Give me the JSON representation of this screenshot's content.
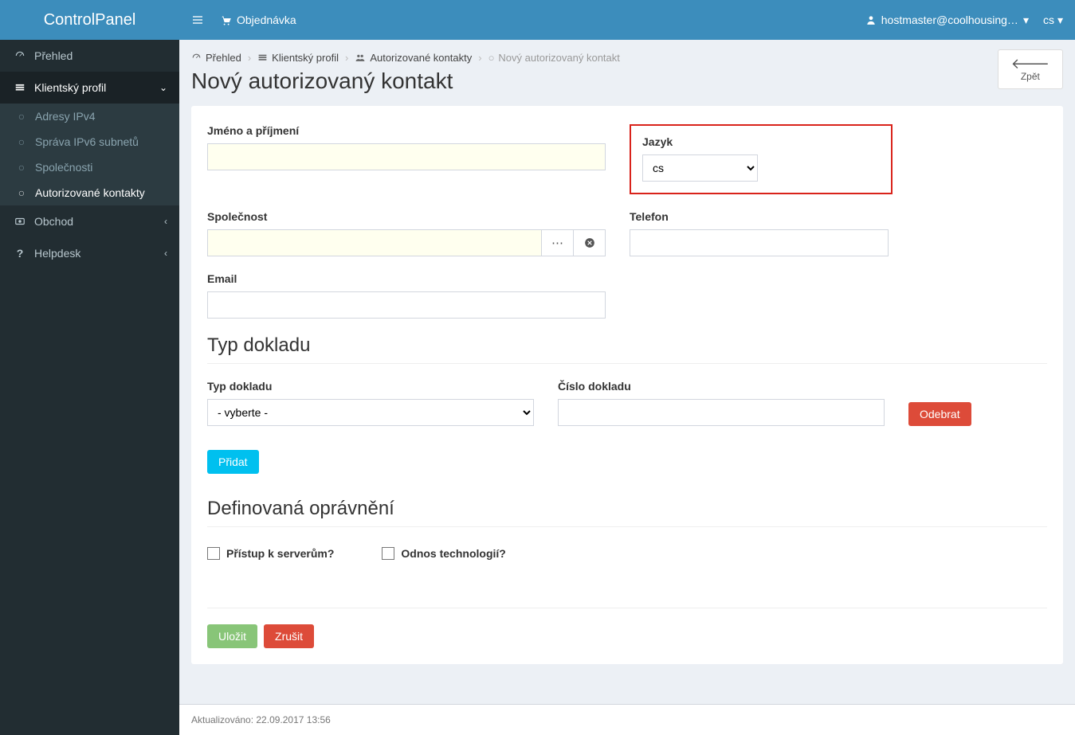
{
  "brand": "ControlPanel",
  "topbar": {
    "order_label": "Objednávka",
    "user": "hostmaster@coolhousing…",
    "lang": "cs"
  },
  "sidebar": {
    "overview": "Přehled",
    "client_profile": "Klientský profil",
    "sub_ipv4": "Adresy IPv4",
    "sub_ipv6": "Správa IPv6 subnetů",
    "sub_companies": "Společnosti",
    "sub_auth_contacts": "Autorizované kontakty",
    "shop": "Obchod",
    "helpdesk": "Helpdesk"
  },
  "breadcrumb": {
    "overview": "Přehled",
    "client_profile": "Klientský profil",
    "auth_contacts": "Autorizované kontakty",
    "new_contact": "Nový autorizovaný kontakt"
  },
  "page_title": "Nový autorizovaný kontakt",
  "back_label": "Zpět",
  "form": {
    "name_label": "Jméno a příjmení",
    "name_value": "",
    "lang_label": "Jazyk",
    "lang_value": "cs",
    "company_label": "Společnost",
    "company_value": "",
    "phone_label": "Telefon",
    "phone_value": "",
    "email_label": "Email",
    "email_value": ""
  },
  "doc_section": {
    "title": "Typ dokladu",
    "type_label": "Typ dokladu",
    "type_selected": "- vyberte -",
    "number_label": "Číslo dokladu",
    "number_value": "",
    "remove_btn": "Odebrat",
    "add_btn": "Přidat"
  },
  "perms_section": {
    "title": "Definovaná oprávnění",
    "server_access": "Přístup k serverům?",
    "tech_removal": "Odnos technologií?"
  },
  "actions": {
    "save": "Uložit",
    "cancel": "Zrušit"
  },
  "footer": {
    "updated": "Aktualizováno: 22.09.2017 13:56"
  }
}
